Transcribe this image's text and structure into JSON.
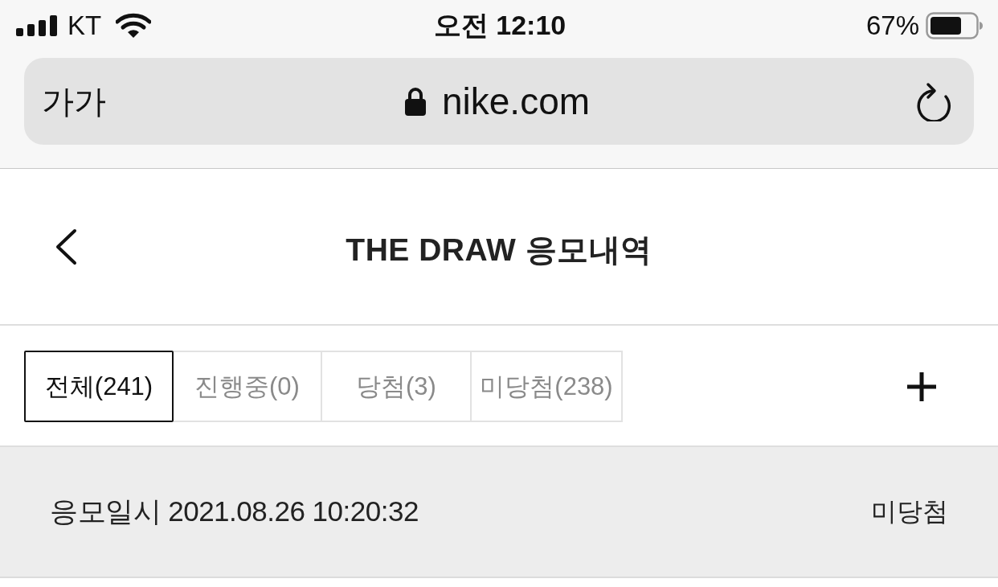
{
  "status_bar": {
    "carrier": "KT",
    "time": "오전 12:10",
    "battery": "67%"
  },
  "browser_bar": {
    "text_size_button": "가가",
    "url": "nike.com"
  },
  "header": {
    "title": "THE DRAW 응모내역"
  },
  "tabs": [
    {
      "label": "전체(241)",
      "selected": true
    },
    {
      "label": "진행중(0)",
      "selected": false
    },
    {
      "label": "당첨(3)",
      "selected": false
    },
    {
      "label": "미당첨(238)",
      "selected": false
    }
  ],
  "entries": [
    {
      "entry_time": "응모일시 2021.08.26 10:20:32",
      "result": "미당첨"
    }
  ]
}
